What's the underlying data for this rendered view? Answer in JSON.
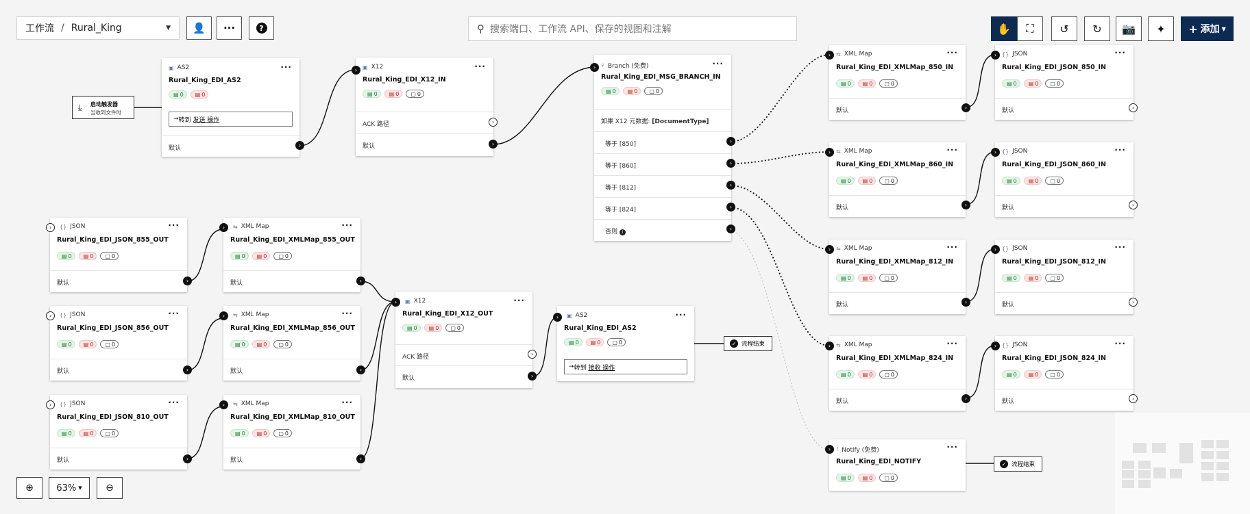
{
  "toolbar": {
    "breadcrumb_root": "工作流",
    "breadcrumb_sep": "/",
    "workflow_name": "Rural_King",
    "search_placeholder": "搜索端口、工作流 API、保存的视图和注解",
    "add_label": "添加"
  },
  "trigger": {
    "title": "启动触发器",
    "subtitle": "当收到文件时"
  },
  "labels": {
    "default": "默认",
    "ack": "ACK 路径",
    "otherwise": "否则",
    "end": "流程结束"
  },
  "nodes": {
    "as2_in": {
      "type": "AS2",
      "name": "Rural_King_EDI_AS2",
      "ok": "0",
      "err": "0",
      "action_arrow": "➞",
      "action_prefix": "转到",
      "action_link": "发送 操作"
    },
    "x12_in": {
      "type": "X12",
      "name": "Rural_King_EDI_X12_IN",
      "ok": "0",
      "err": "0",
      "pending": "0"
    },
    "branch": {
      "type": "Branch (免费)",
      "name": "Rural_King_EDI_MSG_BRANCH_IN",
      "ok": "0",
      "err": "0",
      "pending": "0",
      "condition_prefix": "如果 X12 元数据:",
      "condition_field": "[DocumentType]",
      "cases": [
        "等于 [850]",
        "等于 [860]",
        "等于 [812]",
        "等于 [824]"
      ]
    },
    "xmlmap_850_in": {
      "type": "XML Map",
      "name": "Rural_King_EDI_XMLMap_850_IN",
      "ok": "0",
      "err": "0",
      "pending": "0"
    },
    "xmlmap_860_in": {
      "type": "XML Map",
      "name": "Rural_King_EDI_XMLMap_860_IN",
      "ok": "0",
      "err": "0",
      "pending": "0"
    },
    "xmlmap_812_in": {
      "type": "XML Map",
      "name": "Rural_King_EDI_XMLMap_812_IN",
      "ok": "0",
      "err": "0",
      "pending": "0"
    },
    "xmlmap_824_in": {
      "type": "XML Map",
      "name": "Rural_King_EDI_XMLMap_824_IN",
      "ok": "0",
      "err": "0",
      "pending": "0"
    },
    "json_850_in": {
      "type": "JSON",
      "name": "Rural_King_EDI_JSON_850_IN",
      "ok": "0",
      "err": "0",
      "pending": "0"
    },
    "json_860_in": {
      "type": "JSON",
      "name": "Rural_King_EDI_JSON_860_IN",
      "ok": "0",
      "err": "0",
      "pending": "0"
    },
    "json_812_in": {
      "type": "JSON",
      "name": "Rural_King_EDI_JSON_812_IN",
      "ok": "0",
      "err": "0",
      "pending": "0"
    },
    "json_824_in": {
      "type": "JSON",
      "name": "Rural_King_EDI_JSON_824_IN",
      "ok": "0",
      "err": "0",
      "pending": "0"
    },
    "notify": {
      "type": "Notify (免费)",
      "name": "Rural_King_EDI_NOTIFY",
      "ok": "0",
      "err": "0",
      "pending": "0"
    },
    "json_855_out": {
      "type": "JSON",
      "name": "Rural_King_EDI_JSON_855_OUT",
      "ok": "0",
      "err": "0",
      "pending": "0"
    },
    "json_856_out": {
      "type": "JSON",
      "name": "Rural_King_EDI_JSON_856_OUT",
      "ok": "0",
      "err": "0",
      "pending": "0"
    },
    "json_810_out": {
      "type": "JSON",
      "name": "Rural_King_EDI_JSON_810_OUT",
      "ok": "0",
      "err": "0",
      "pending": "0"
    },
    "xmlmap_855_out": {
      "type": "XML Map",
      "name": "Rural_King_EDI_XMLMap_855_OUT",
      "ok": "0",
      "err": "0",
      "pending": "0"
    },
    "xmlmap_856_out": {
      "type": "XML Map",
      "name": "Rural_King_EDI_XMLMap_856_OUT",
      "ok": "0",
      "err": "0",
      "pending": "0"
    },
    "xmlmap_810_out": {
      "type": "XML Map",
      "name": "Rural_King_EDI_XMLMap_810_OUT",
      "ok": "0",
      "err": "0",
      "pending": "0"
    },
    "x12_out": {
      "type": "X12",
      "name": "Rural_King_EDI_X12_OUT",
      "ok": "0",
      "err": "0",
      "pending": "0"
    },
    "as2_out": {
      "type": "AS2",
      "name": "Rural_King_EDI_AS2",
      "ok": "0",
      "err": "0",
      "pending": "0",
      "action_arrow": "➞",
      "action_prefix": "转到",
      "action_link": "接收 操作"
    }
  },
  "zoom": {
    "level": "63%"
  },
  "colors": {
    "primary": "#0d2a52",
    "success": "#1e7a36",
    "error": "#b3261e",
    "canvas": "#f4f4f4"
  }
}
